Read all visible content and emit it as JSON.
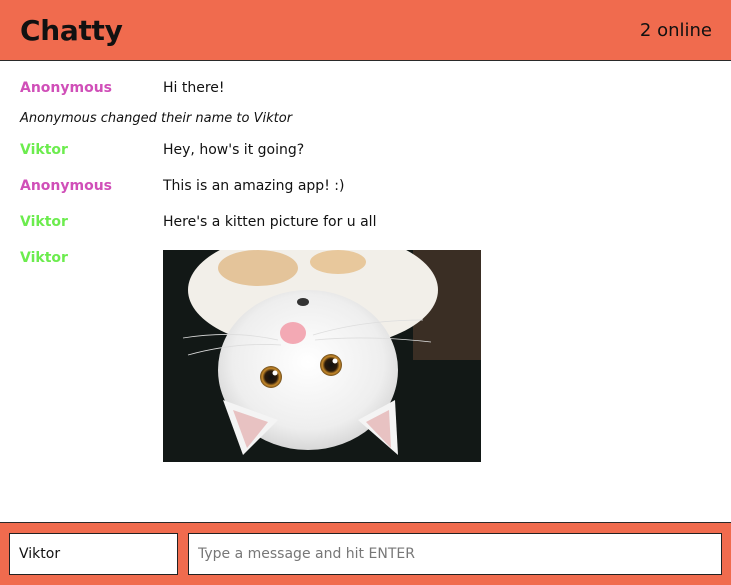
{
  "header": {
    "brand": "Chatty",
    "users_online": "2 online"
  },
  "colors": {
    "bar": "#f06b4e",
    "anonymous": "#d04fb8",
    "viktor": "#6cec4e"
  },
  "messages": [
    {
      "username": "Anonymous",
      "content": "Hi there!"
    },
    {
      "notification": "Anonymous changed their name to Viktor"
    },
    {
      "username": "Viktor",
      "content": "Hey, how's it going?"
    },
    {
      "username": "Anonymous",
      "content": "This is an amazing app! :)"
    },
    {
      "username": "Viktor",
      "content": "Here's a kitten picture for u all"
    },
    {
      "username": "Viktor",
      "image": "kitten-photo"
    }
  ],
  "chatbar": {
    "username_value": "Viktor",
    "message_placeholder": "Type a message and hit ENTER"
  }
}
